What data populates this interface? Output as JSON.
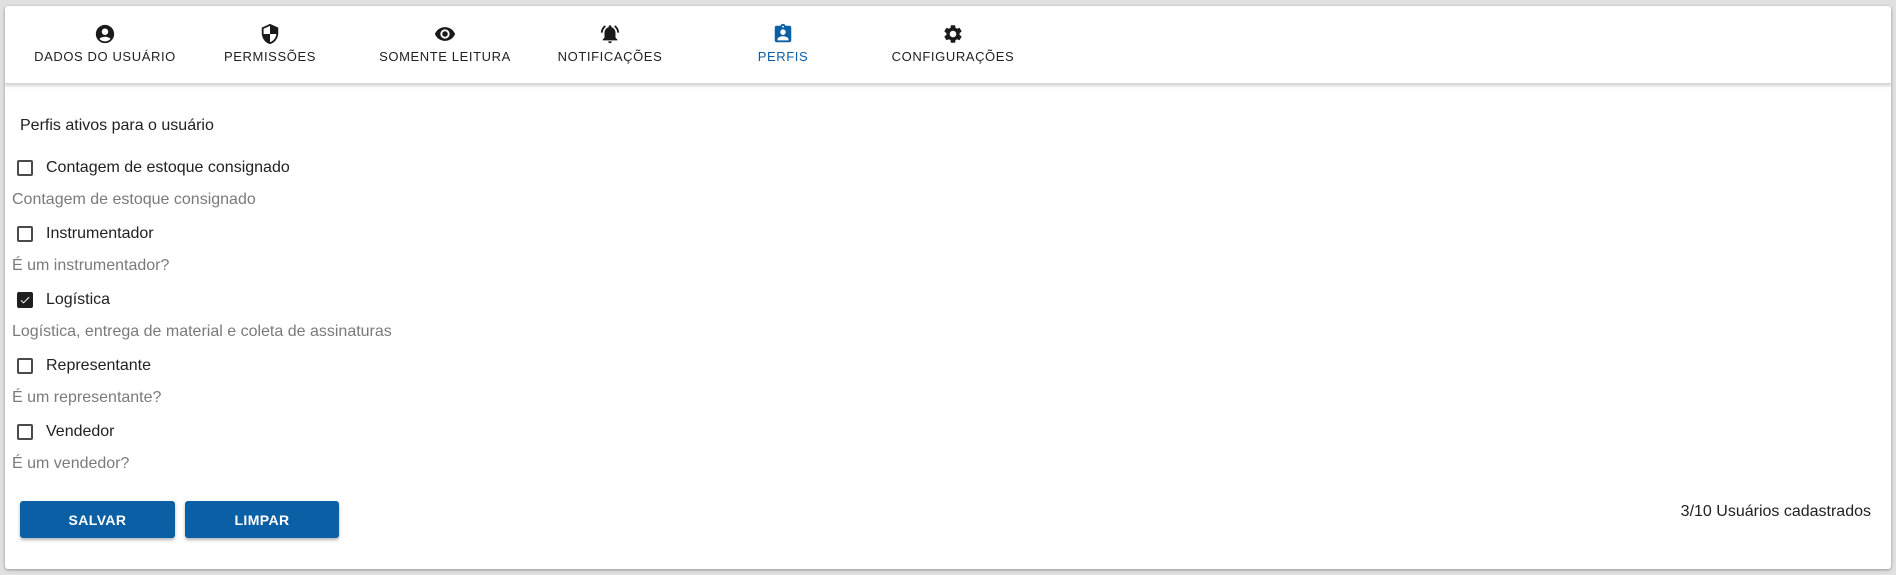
{
  "tabs": [
    {
      "label": "DADOS DO USUÁRIO",
      "icon": "account-circle-icon",
      "active": false
    },
    {
      "label": "PERMISSÕES",
      "icon": "shield-icon",
      "active": false
    },
    {
      "label": "SOMENTE LEITURA",
      "icon": "eye-icon",
      "active": false
    },
    {
      "label": "NOTIFICAÇÕES",
      "icon": "bell-ringing-icon",
      "active": false
    },
    {
      "label": "PERFIS",
      "icon": "badge-icon",
      "active": true
    },
    {
      "label": "CONFIGURAÇÕES",
      "icon": "gear-icon",
      "active": false
    }
  ],
  "profiles": {
    "title": "Perfis ativos para o usuário",
    "items": [
      {
        "label": "Contagem de estoque consignado",
        "description": "Contagem de estoque consignado",
        "checked": false
      },
      {
        "label": "Instrumentador",
        "description": "É um instrumentador?",
        "checked": false
      },
      {
        "label": "Logística",
        "description": "Logística, entrega de material e coleta de assinaturas",
        "checked": true
      },
      {
        "label": "Representante",
        "description": "É um representante?",
        "checked": false
      },
      {
        "label": "Vendedor",
        "description": "É um vendedor?",
        "checked": false
      }
    ]
  },
  "actions": {
    "save_label": "SALVAR",
    "clear_label": "LIMPAR"
  },
  "footer": {
    "user_count": "3/10 Usuários cadastrados"
  },
  "colors": {
    "accent": "#0b5fa5",
    "text": "#212121",
    "muted": "#7a7a7a"
  }
}
